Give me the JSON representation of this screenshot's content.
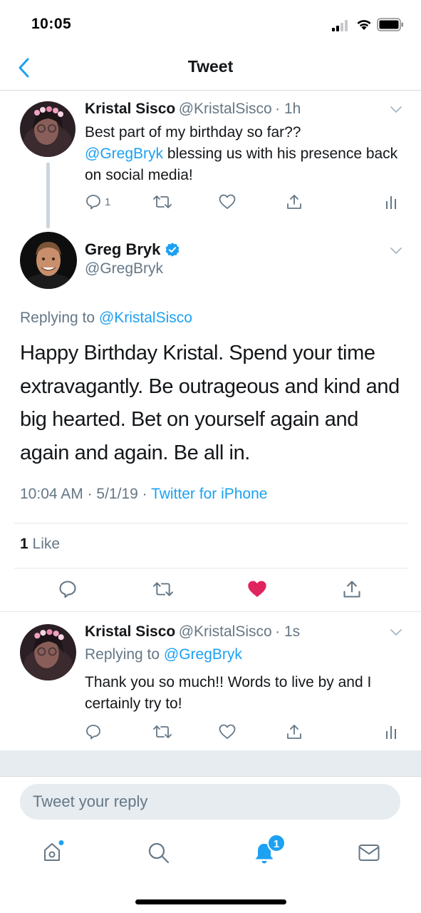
{
  "status_bar": {
    "time": "10:05"
  },
  "nav": {
    "title": "Tweet",
    "back_icon": "chevron-left-icon"
  },
  "parent_tweet": {
    "name": "Kristal Sisco",
    "handle": "@KristalSisco",
    "time": "· 1h",
    "text_before_mention": "Best part of my birthday so far??",
    "mention": "@GregBryk",
    "text_after_mention": " blessing us with his presence back on social media!",
    "reply_count": "1"
  },
  "main_tweet": {
    "name": "Greg Bryk",
    "handle": "@GregBryk",
    "replying_prefix": "Replying to ",
    "replying_to": "@KristalSisco",
    "text": "Happy Birthday Kristal. Spend your time extravagantly. Be outrageous and kind and big hearted. Bet on yourself again and again and again. Be all in.",
    "timestamp": "10:04 AM · 5/1/19 · ",
    "source": "Twitter for iPhone",
    "likes_count": "1",
    "likes_label": " Like",
    "liked_color": "#e0245e"
  },
  "reply_tweet": {
    "name": "Kristal Sisco",
    "handle": "@KristalSisco",
    "time": "· 1s",
    "replying_prefix": "Replying to ",
    "replying_to": "@GregBryk",
    "text": "Thank you so much!! Words to live by and I certainly try to!"
  },
  "composer": {
    "placeholder": "Tweet your reply"
  },
  "tab_bar": {
    "items": [
      "home-icon",
      "search-icon",
      "notifications-icon",
      "messages-icon"
    ],
    "notification_badge": "1"
  },
  "colors": {
    "accent": "#1da1f2",
    "text_secondary": "#657786",
    "like": "#e0245e"
  }
}
